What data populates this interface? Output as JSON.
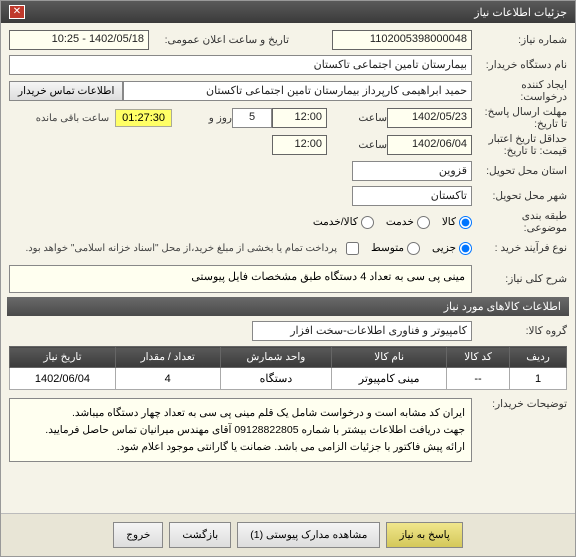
{
  "titlebar": {
    "title": "جزئیات اطلاعات نیاز",
    "close": "✕"
  },
  "fields": {
    "need_no_lbl": "شماره نیاز:",
    "need_no": "1102005398000048",
    "announce_lbl": "تاریخ و ساعت اعلان عمومی:",
    "announce_val": "1402/05/18 - 10:25",
    "buyer_org_lbl": "نام دستگاه خریدار:",
    "buyer_org": "بیمارستان تامین اجتماعی تاکستان",
    "creator_lbl": "ایجاد کننده درخواست:",
    "creator": "حمید ابراهیمی کارپرداز بیمارستان تامین اجتماعی تاکستان",
    "contact_btn": "اطلاعات تماس خریدار",
    "deadline_lbl": "مهلت ارسال پاسخ: تا تاریخ:",
    "deadline_date": "1402/05/23",
    "time_lbl": "ساعت",
    "deadline_time": "12:00",
    "days_lbl": "روز و",
    "days_val": "5",
    "remaining": "01:27:30",
    "remaining_lbl": "ساعت باقی مانده",
    "min_valid_lbl": "حداقل تاریخ اعتبار قیمت: تا تاریخ:",
    "min_valid_date": "1402/06/04",
    "min_valid_time": "12:00",
    "province_lbl": "استان محل تحویل:",
    "province": "قزوین",
    "city_lbl": "شهر محل تحویل:",
    "city": "تاکستان",
    "category_lbl": "طبقه بندی موضوعی:",
    "cat_kala": "کالا",
    "cat_service": "خدمت",
    "cat_both": "کالا/خدمت",
    "process_lbl": "نوع فرآیند خرید :",
    "proc_low": "جزیی",
    "proc_mid": "متوسط",
    "proc_note": "پرداخت تمام یا بخشی از مبلغ خرید،از محل \"اسناد خزانه اسلامی\" خواهد بود.",
    "need_title_lbl": "شرح کلی نیاز:",
    "need_title": "مینی پی سی به تعداد 4 دستگاه طبق مشخصات فایل پیوستی",
    "items_hdr": "اطلاعات کالاهای مورد نیاز",
    "group_lbl": "گروه کالا:",
    "group_val": "کامپیوتر و فناوری اطلاعات-سخت افزار",
    "buyer_notes_lbl": "توضیحات خریدار:",
    "buyer_notes_1": "ایران کد مشابه است و درخواست شامل یک قلم مینی پی سی به تعداد چهار دستگاه میباشد.",
    "buyer_notes_2": "جهت دریافت اطلاعات بیشتر با شماره 09128822805 آقای مهندس میرانیان تماس حاصل فرمایید.",
    "buyer_notes_3": "ارائه پیش فاکتور با جزئیات الزامی می باشد. ضمانت یا گارانتی موجود اعلام شود."
  },
  "table": {
    "headers": {
      "row": "ردیف",
      "code": "کد کالا",
      "name": "نام کالا",
      "unit": "واحد شمارش",
      "qty": "تعداد / مقدار",
      "date": "تاریخ نیاز"
    },
    "rows": [
      {
        "row": "1",
        "code": "--",
        "name": "مینی کامپیوتر",
        "unit": "دستگاه",
        "qty": "4",
        "date": "1402/06/04"
      }
    ]
  },
  "footer": {
    "reply": "پاسخ به نیاز",
    "attachments": "مشاهده مدارک پیوستی (1)",
    "back": "بازگشت",
    "exit": "خروج"
  }
}
